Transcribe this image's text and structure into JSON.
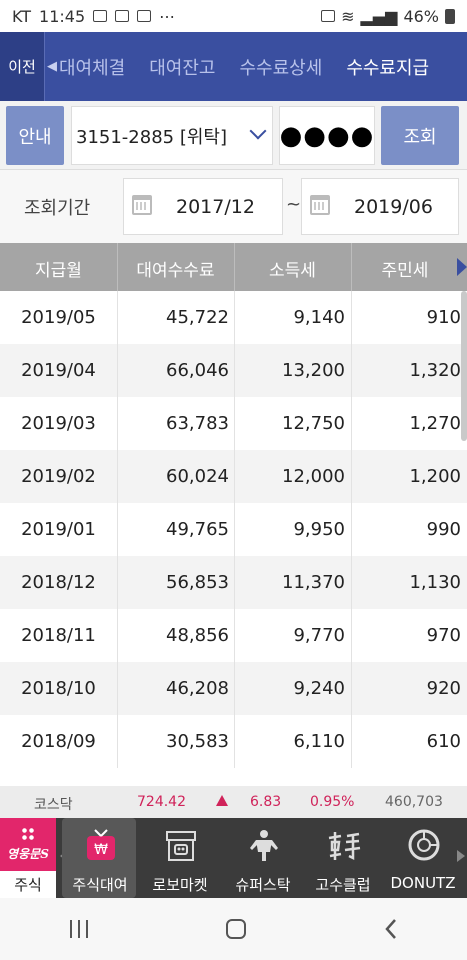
{
  "status_bar": {
    "carrier": "KT",
    "time": "11:45",
    "extra_icons": "⋯",
    "battery": "46%"
  },
  "top_nav": {
    "back_label": "이전",
    "tabs": [
      {
        "label": "대여체결",
        "active": false
      },
      {
        "label": "대여잔고",
        "active": false
      },
      {
        "label": "수수료상세",
        "active": false
      },
      {
        "label": "수수료지급",
        "active": true
      }
    ]
  },
  "search": {
    "guide_label": "안내",
    "account_value": "3151-2885 [위탁]",
    "password_mask": "●●●●",
    "query_label": "조회"
  },
  "period": {
    "label": "조회기간",
    "start": "2017/12",
    "separator": "~",
    "end": "2019/06"
  },
  "table": {
    "headers": [
      "지급월",
      "대여수수료",
      "소득세",
      "주민세"
    ],
    "rows": [
      [
        "2019/05",
        "45,722",
        "9,140",
        "910"
      ],
      [
        "2019/04",
        "66,046",
        "13,200",
        "1,320"
      ],
      [
        "2019/03",
        "63,783",
        "12,750",
        "1,270"
      ],
      [
        "2019/02",
        "60,024",
        "12,000",
        "1,200"
      ],
      [
        "2019/01",
        "49,765",
        "9,950",
        "990"
      ],
      [
        "2018/12",
        "56,853",
        "11,370",
        "1,130"
      ],
      [
        "2018/11",
        "48,856",
        "9,770",
        "970"
      ],
      [
        "2018/10",
        "46,208",
        "9,240",
        "920"
      ],
      [
        "2018/09",
        "30,583",
        "6,110",
        "610"
      ]
    ]
  },
  "ticker": {
    "name": "코스닥",
    "price": "724.42",
    "change": "6.83",
    "percent": "0.95%",
    "volume": "460,703",
    "accent_color": "#d0235a"
  },
  "bottom_menu": {
    "brand_label": "주식",
    "brand_logo": "영웅문S",
    "items": [
      {
        "label": "주식대여",
        "icon": "won-tv-icon",
        "active": true
      },
      {
        "label": "로보마켓",
        "icon": "robot-shop-icon",
        "active": false
      },
      {
        "label": "슈퍼스탁",
        "icon": "superhero-icon",
        "active": false
      },
      {
        "label": "고수클럽",
        "icon": "gosu-calligraphy-icon",
        "active": false
      },
      {
        "label": "DONUTZ",
        "icon": "donut-chart-icon",
        "active": false
      }
    ]
  },
  "colors": {
    "nav_bg": "#3a4fa0",
    "button_bg": "#7b8fc7",
    "header_bg": "#a5a5a5",
    "brand_pink": "#e2266b"
  }
}
